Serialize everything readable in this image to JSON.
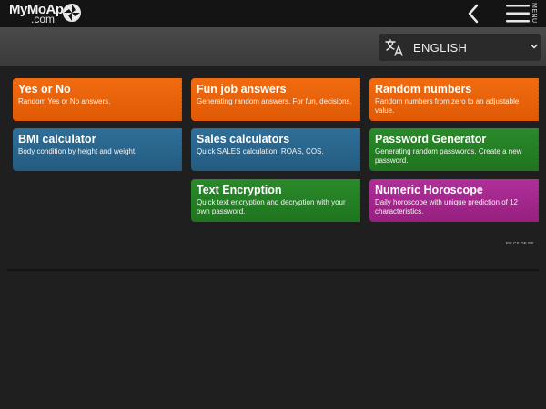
{
  "header": {
    "logo_top": "MyMoAp",
    "logo_bottom": ".com",
    "menu_label": "MENU"
  },
  "language": {
    "selected": "ENGLISH"
  },
  "cards": [
    {
      "title": "Yes or No",
      "desc": "Random Yes or No answers.",
      "color": "#f06b10"
    },
    {
      "title": "Fun job answers",
      "desc": "Generating random answers. For fun, decisions.",
      "color": "#f06b10"
    },
    {
      "title": "Random numbers",
      "desc": "Random numbers from zero to an adjustable value.",
      "color": "#f06b10"
    },
    {
      "title": "BMI calculator",
      "desc": "Body condition by height and weight.",
      "color": "#2f6f99"
    },
    {
      "title": "Sales calculators",
      "desc": "Quick SALES calculation. ROAS, COS.",
      "color": "#2f6f99"
    },
    {
      "title": "Password Generator",
      "desc": "Generating random passwords. Create a new password.",
      "color": "#2a8a2a"
    },
    {
      "title": "Text Encryption",
      "desc": "Quick text encryption and decryption with your own password.",
      "color": "#2a8a2a"
    },
    {
      "title": "Numeric Horoscope",
      "desc": "Daily horoscope with unique prediction of 12 characteristics.",
      "color": "#b02f9a"
    }
  ],
  "footer": {
    "languages": "EN CS DE ES"
  }
}
